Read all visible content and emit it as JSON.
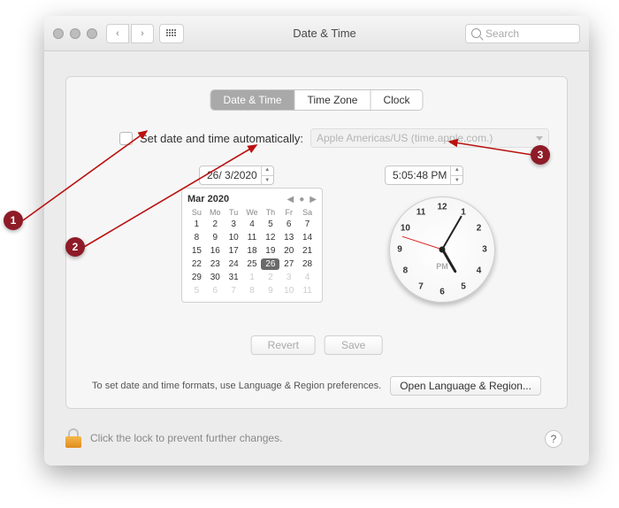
{
  "window": {
    "title": "Date & Time"
  },
  "search": {
    "placeholder": "Search"
  },
  "tabs": {
    "t0": "Date & Time",
    "t1": "Time Zone",
    "t2": "Clock",
    "active": 0
  },
  "auto": {
    "label": "Set date and time automatically:",
    "server": "Apple Americas/US (time.apple.com.)",
    "checked": false
  },
  "date_field": "26/  3/2020",
  "time_field": "5:05:48 PM",
  "calendar": {
    "month_label": "Mar 2020",
    "day_headers": [
      "Su",
      "Mo",
      "Tu",
      "We",
      "Th",
      "Fr",
      "Sa"
    ],
    "weeks": [
      [
        {
          "n": 1
        },
        {
          "n": 2
        },
        {
          "n": 3
        },
        {
          "n": 4
        },
        {
          "n": 5
        },
        {
          "n": 6
        },
        {
          "n": 7
        }
      ],
      [
        {
          "n": 8
        },
        {
          "n": 9
        },
        {
          "n": 10
        },
        {
          "n": 11
        },
        {
          "n": 12
        },
        {
          "n": 13
        },
        {
          "n": 14
        }
      ],
      [
        {
          "n": 15
        },
        {
          "n": 16
        },
        {
          "n": 17
        },
        {
          "n": 18
        },
        {
          "n": 19
        },
        {
          "n": 20
        },
        {
          "n": 21
        }
      ],
      [
        {
          "n": 22
        },
        {
          "n": 23
        },
        {
          "n": 24
        },
        {
          "n": 25
        },
        {
          "n": 26,
          "sel": true
        },
        {
          "n": 27
        },
        {
          "n": 28
        }
      ],
      [
        {
          "n": 29
        },
        {
          "n": 30
        },
        {
          "n": 31
        },
        {
          "n": 1,
          "o": true
        },
        {
          "n": 2,
          "o": true
        },
        {
          "n": 3,
          "o": true
        },
        {
          "n": 4,
          "o": true
        }
      ],
      [
        {
          "n": 5,
          "o": true
        },
        {
          "n": 6,
          "o": true
        },
        {
          "n": 7,
          "o": true
        },
        {
          "n": 8,
          "o": true
        },
        {
          "n": 9,
          "o": true
        },
        {
          "n": 10,
          "o": true
        },
        {
          "n": 11,
          "o": true
        }
      ]
    ]
  },
  "clock": {
    "numbers": [
      "12",
      "1",
      "2",
      "3",
      "4",
      "5",
      "6",
      "7",
      "8",
      "9",
      "10",
      "11"
    ],
    "ampm": "PM"
  },
  "buttons": {
    "revert": "Revert",
    "save": "Save",
    "open_lang": "Open Language & Region..."
  },
  "hint": "To set date and time formats, use Language & Region preferences.",
  "lock_text": "Click the lock to prevent further changes.",
  "annotations": {
    "a1": "1",
    "a2": "2",
    "a3": "3"
  }
}
